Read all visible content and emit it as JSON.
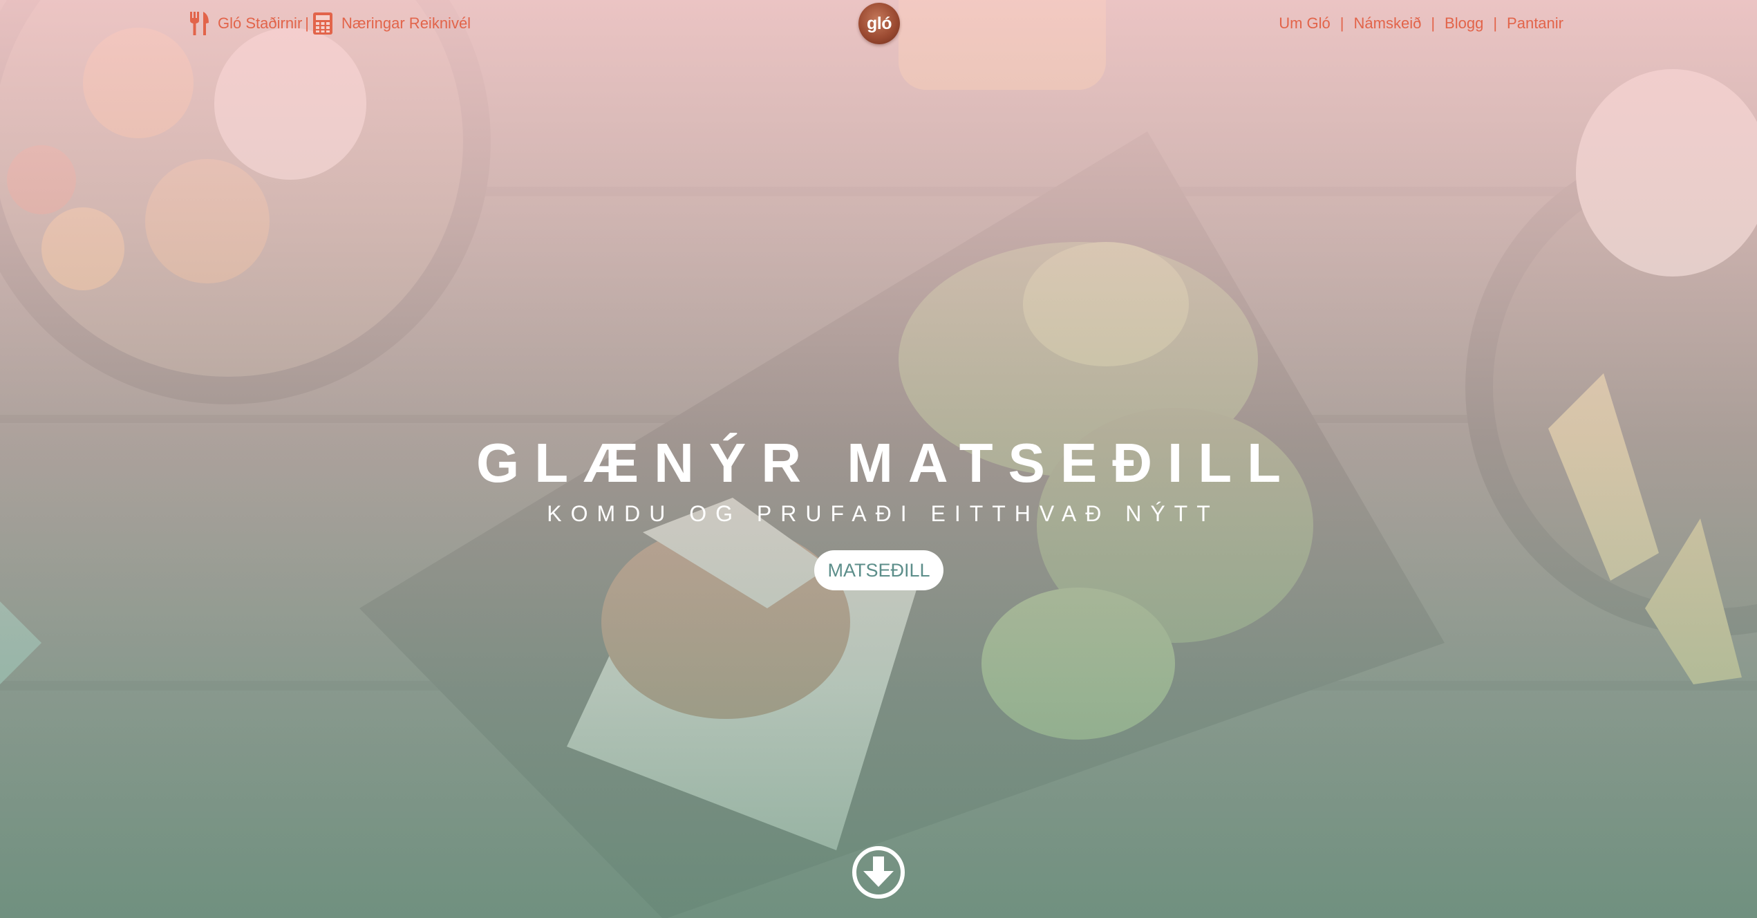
{
  "header": {
    "left_links": [
      {
        "label": "Gló Staðirnir",
        "icon": "fork-knife-icon"
      },
      {
        "label": "Næringar Reiknivél",
        "icon": "calculator-icon"
      }
    ],
    "left_separator": "|",
    "logo_text": "gló",
    "right_links": [
      {
        "label": "Um Gló"
      },
      {
        "label": "Námskeið"
      },
      {
        "label": "Blogg"
      },
      {
        "label": "Pantanir"
      }
    ],
    "right_separator": "|"
  },
  "hero": {
    "headline": "GLÆNÝR MATSEÐILL",
    "subheadline": "KOMDU OG PRUFAÐI EITTHVAÐ NÝTT",
    "button_label": "MATSEÐILL",
    "scroll_icon": "arrow-down-circle-icon"
  },
  "colors": {
    "nav_link": "#e2644a",
    "button_text": "#5c8e8a",
    "headline": "#ffffff",
    "logo": "#9c4b32"
  }
}
